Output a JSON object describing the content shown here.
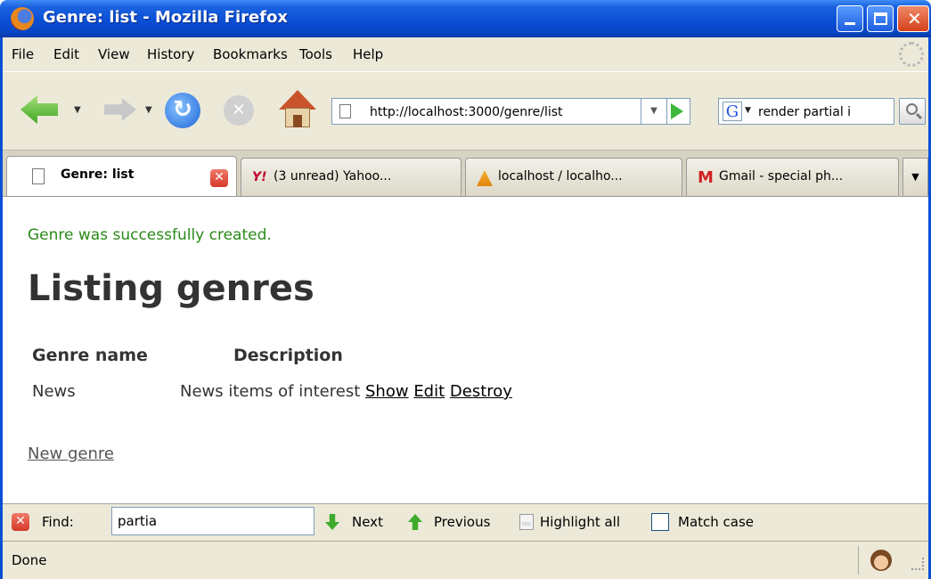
{
  "window": {
    "title": "Genre: list - Mozilla Firefox"
  },
  "menu": {
    "file": "File",
    "edit": "Edit",
    "view": "View",
    "history": "History",
    "bookmarks": "Bookmarks",
    "tools": "Tools",
    "help": "Help"
  },
  "toolbar": {
    "url": "http://localhost:3000/genre/list",
    "search_value": "render partial i",
    "search_engine_letter": "G"
  },
  "tabs": [
    {
      "label": "Genre: list",
      "active": true
    },
    {
      "label": "(3 unread) Yahoo...",
      "active": false
    },
    {
      "label": "localhost / localho...",
      "active": false
    },
    {
      "label": "Gmail - special ph...",
      "active": false
    }
  ],
  "page": {
    "notice": "Genre was successfully created.",
    "heading": "Listing genres",
    "columns": [
      "Genre name",
      "Description"
    ],
    "rows": [
      {
        "name": "News",
        "description": "News items of interest",
        "actions": [
          "Show",
          "Edit",
          "Destroy"
        ]
      }
    ],
    "new_link": "New genre"
  },
  "findbar": {
    "label": "Find:",
    "value": "partia",
    "next": "Next",
    "previous": "Previous",
    "highlight": "Highlight all",
    "match_case": "Match case"
  },
  "status": {
    "text": "Done"
  },
  "colors": {
    "titlebar": "#0a4fd6",
    "notice": "#2a8a1a",
    "chrome": "#ece9d8"
  }
}
